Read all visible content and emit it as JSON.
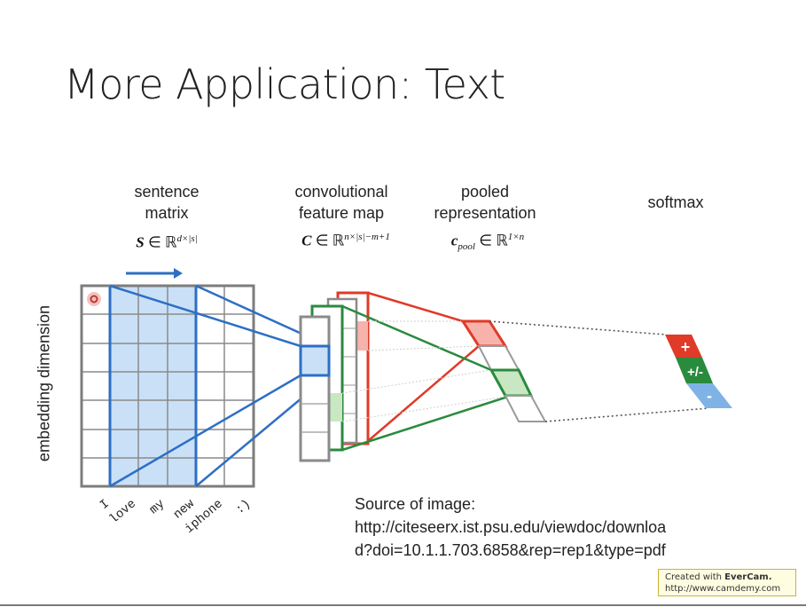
{
  "slide": {
    "title": "More Application: Text"
  },
  "diagram": {
    "sentence_matrix_label": [
      "sentence",
      "matrix"
    ],
    "conv_label": [
      "convolutional",
      "feature map"
    ],
    "pooled_label": [
      "pooled",
      "representation"
    ],
    "softmax_label": "softmax",
    "y_axis_label": "embedding dimension",
    "words": [
      "I",
      "love",
      "my",
      "new",
      "iphone",
      ":)"
    ],
    "softmax_outputs": [
      "+",
      "+/-",
      "-"
    ],
    "colors": {
      "blue": "#2d6fc4",
      "red": "#e03a28",
      "green": "#2a8a3e",
      "grey": "#7d7d7d",
      "light_blue": "#c9e0f7"
    }
  },
  "source": {
    "line1": "Source of image:",
    "line2": "http://citeseerx.ist.psu.edu/viewdoc/downloa",
    "line3": "d?doi=10.1.1.703.6858&rep=rep1&type=pdf"
  },
  "watermark": {
    "prefix": "Created with ",
    "brand": "EverCam.",
    "url": "http://www.camdemy.com"
  }
}
